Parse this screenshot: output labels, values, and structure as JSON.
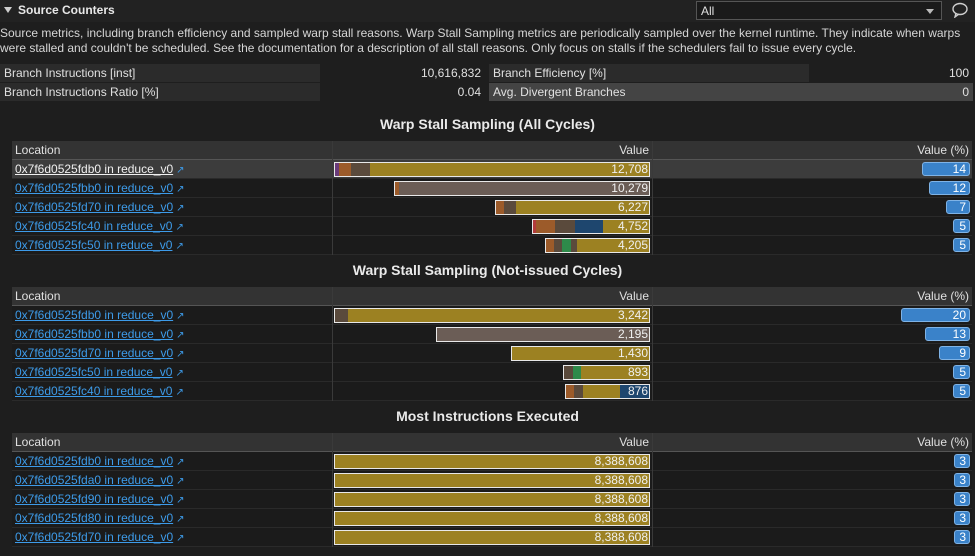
{
  "header": {
    "title": "Source Counters",
    "filter_value": "All"
  },
  "description": "Source metrics, including branch efficiency and sampled warp stall reasons. Warp Stall Sampling metrics are periodically sampled over the kernel runtime. They indicate when warps were stalled and couldn't be scheduled. See the documentation for a description of all stall reasons. Only focus on stalls if the schedulers fail to issue every cycle.",
  "metrics": [
    {
      "label": "Branch Instructions [inst]",
      "value": "10,616,832"
    },
    {
      "label": "Branch Efficiency [%]",
      "value": "100"
    },
    {
      "label": "Branch Instructions Ratio [%]",
      "value": "0.04"
    },
    {
      "label": "Avg. Divergent Branches",
      "value": "0"
    }
  ],
  "columns": {
    "location": "Location",
    "value": "Value",
    "value_pct": "Value (%)"
  },
  "colors": {
    "olive": "#9c8122",
    "brown": "#5a4a3c",
    "taupe": "#6b5d56",
    "navy": "#1e466e",
    "rust": "#9c5b2a",
    "green": "#2e8a4a",
    "red": "#b23b3b",
    "purple": "#6a3b7a"
  },
  "tables": [
    {
      "title": "Warp Stall Sampling (All Cycles)",
      "max": 12708,
      "rows": [
        {
          "location": "0x7f6d0525fdb0 in reduce_v0",
          "value": "12,708",
          "num": 12708,
          "pct": 14,
          "selected": true,
          "segs": [
            [
              "purple",
              0.012
            ],
            [
              "rust",
              0.04
            ],
            [
              "brown",
              0.06
            ],
            [
              "olive",
              0.888
            ]
          ]
        },
        {
          "location": "0x7f6d0525fbb0 in reduce_v0",
          "value": "10,279",
          "num": 10279,
          "pct": 12,
          "segs": [
            [
              "rust",
              0.015
            ],
            [
              "taupe",
              0.985
            ]
          ]
        },
        {
          "location": "0x7f6d0525fd70 in reduce_v0",
          "value": "6,227",
          "num": 6227,
          "pct": 7,
          "segs": [
            [
              "rust",
              0.05
            ],
            [
              "brown",
              0.08
            ],
            [
              "olive",
              0.87
            ]
          ]
        },
        {
          "location": "0x7f6d0525fc40 in reduce_v0",
          "value": "4,752",
          "num": 4752,
          "pct": 5,
          "segs": [
            [
              "red",
              0.03
            ],
            [
              "rust",
              0.16
            ],
            [
              "brown",
              0.17
            ],
            [
              "navy",
              0.24
            ],
            [
              "olive",
              0.4
            ]
          ]
        },
        {
          "location": "0x7f6d0525fc50 in reduce_v0",
          "value": "4,205",
          "num": 4205,
          "pct": 5,
          "segs": [
            [
              "rust",
              0.08
            ],
            [
              "brown",
              0.08
            ],
            [
              "green",
              0.08
            ],
            [
              "brown",
              0.06
            ],
            [
              "olive",
              0.7
            ]
          ]
        }
      ]
    },
    {
      "title": "Warp Stall Sampling (Not-issued Cycles)",
      "max": 3242,
      "rows": [
        {
          "location": "0x7f6d0525fdb0 in reduce_v0",
          "value": "3,242",
          "num": 3242,
          "pct": 20,
          "segs": [
            [
              "brown",
              0.04
            ],
            [
              "olive",
              0.96
            ]
          ]
        },
        {
          "location": "0x7f6d0525fbb0 in reduce_v0",
          "value": "2,195",
          "num": 2195,
          "pct": 13,
          "segs": [
            [
              "taupe",
              1.0
            ]
          ]
        },
        {
          "location": "0x7f6d0525fd70 in reduce_v0",
          "value": "1,430",
          "num": 1430,
          "pct": 9,
          "segs": [
            [
              "olive",
              1.0
            ]
          ]
        },
        {
          "location": "0x7f6d0525fc50 in reduce_v0",
          "value": "893",
          "num": 893,
          "pct": 5,
          "segs": [
            [
              "brown",
              0.1
            ],
            [
              "green",
              0.1
            ],
            [
              "olive",
              0.8
            ]
          ]
        },
        {
          "location": "0x7f6d0525fc40 in reduce_v0",
          "value": "876",
          "num": 876,
          "pct": 5,
          "segs": [
            [
              "rust",
              0.1
            ],
            [
              "brown",
              0.1
            ],
            [
              "olive",
              0.45
            ],
            [
              "navy",
              0.35
            ]
          ]
        }
      ]
    },
    {
      "title": "Most Instructions Executed",
      "max": 8388608,
      "rows": [
        {
          "location": "0x7f6d0525fdb0 in reduce_v0",
          "value": "8,388,608",
          "num": 8388608,
          "pct": 3,
          "segs": [
            [
              "olive",
              1.0
            ]
          ]
        },
        {
          "location": "0x7f6d0525fda0 in reduce_v0",
          "value": "8,388,608",
          "num": 8388608,
          "pct": 3,
          "segs": [
            [
              "olive",
              1.0
            ]
          ]
        },
        {
          "location": "0x7f6d0525fd90 in reduce_v0",
          "value": "8,388,608",
          "num": 8388608,
          "pct": 3,
          "segs": [
            [
              "olive",
              1.0
            ]
          ]
        },
        {
          "location": "0x7f6d0525fd80 in reduce_v0",
          "value": "8,388,608",
          "num": 8388608,
          "pct": 3,
          "segs": [
            [
              "olive",
              1.0
            ]
          ]
        },
        {
          "location": "0x7f6d0525fd70 in reduce_v0",
          "value": "8,388,608",
          "num": 8388608,
          "pct": 3,
          "segs": [
            [
              "olive",
              1.0
            ]
          ]
        }
      ]
    }
  ]
}
